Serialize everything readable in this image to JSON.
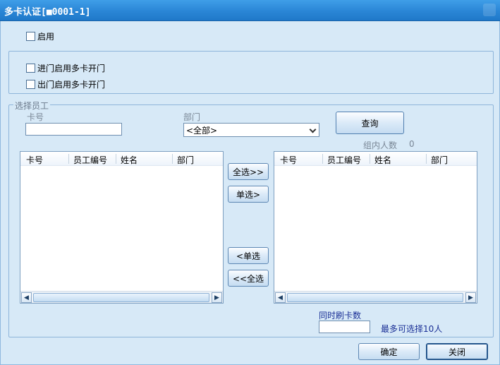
{
  "window": {
    "title": "多卡认证[■0001-1]"
  },
  "enable": {
    "label": "启用"
  },
  "door_options": {
    "entry_label": "进门启用多卡开门",
    "exit_label": "出门启用多卡开门"
  },
  "select_group": {
    "legend": "选择员工",
    "card_no_label": "卡号",
    "card_no_value": "",
    "dept_label": "部门",
    "dept_value": "<全部>",
    "query_button": "查询",
    "group_count_label": "组内人数",
    "group_count_value": "0"
  },
  "left_list": {
    "columns": [
      "卡号",
      "员工编号",
      "姓名",
      "部门"
    ]
  },
  "right_list": {
    "columns": [
      "卡号",
      "员工编号",
      "姓名",
      "部门"
    ]
  },
  "move_buttons": {
    "add_all": "全选>>",
    "add_one": "单选>",
    "remove_one": "<单选",
    "remove_all": "<<全选"
  },
  "simultaneous": {
    "label": "同时刷卡数",
    "value": "",
    "hint": "最多可选择10人"
  },
  "footer": {
    "ok_button": "确定",
    "close_button": "关闭"
  },
  "icons": {
    "scroll_left": "◀",
    "scroll_right": "▶"
  },
  "colors": {
    "title_bar": "#2a86d6",
    "background": "#d7e9f7",
    "accent_text": "#1a2f96"
  }
}
